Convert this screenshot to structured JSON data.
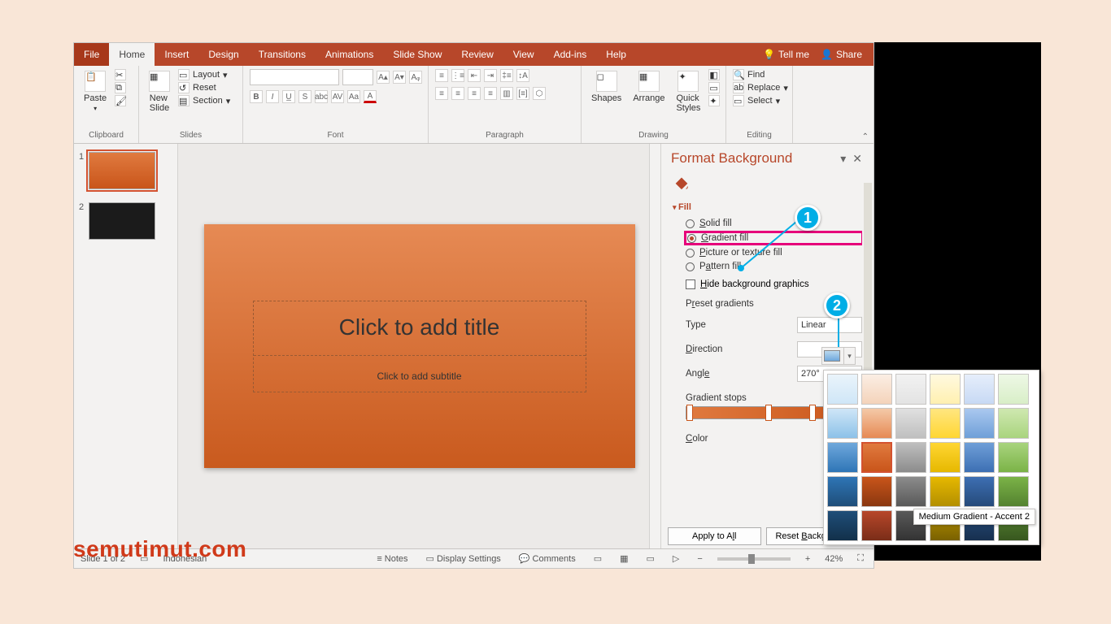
{
  "tabs": {
    "file": "File",
    "home": "Home",
    "insert": "Insert",
    "design": "Design",
    "transitions": "Transitions",
    "animations": "Animations",
    "slideshow": "Slide Show",
    "review": "Review",
    "view": "View",
    "addins": "Add-ins",
    "help": "Help",
    "tellme": "Tell me",
    "share": "Share"
  },
  "ribbon": {
    "clipboard": {
      "label": "Clipboard",
      "paste": "Paste"
    },
    "slides": {
      "label": "Slides",
      "newslide": "New\nSlide",
      "layout": "Layout",
      "reset": "Reset",
      "section": "Section"
    },
    "font": {
      "label": "Font"
    },
    "paragraph": {
      "label": "Paragraph"
    },
    "drawing": {
      "label": "Drawing",
      "shapes": "Shapes",
      "arrange": "Arrange",
      "quick": "Quick\nStyles"
    },
    "editing": {
      "label": "Editing",
      "find": "Find",
      "replace": "Replace",
      "select": "Select"
    }
  },
  "thumbs": {
    "n1": "1",
    "n2": "2"
  },
  "slide": {
    "title_ph": "Click to add title",
    "subtitle_ph": "Click to add subtitle"
  },
  "pane": {
    "title": "Format Background",
    "fill": "Fill",
    "solid": "Solid fill",
    "gradient": "Gradient fill",
    "picture": "Picture or texture fill",
    "pattern": "Pattern fill",
    "hide": "Hide background graphics",
    "preset": "Preset gradients",
    "type": "Type",
    "type_val": "Linear",
    "direction": "Direction",
    "angle": "Angle",
    "angle_val": "270°",
    "stops": "Gradient stops",
    "color": "Color",
    "apply": "Apply to All",
    "reset": "Reset Background"
  },
  "popup_tooltip": "Medium Gradient - Accent 2",
  "status": {
    "slide": "Slide 1 of 2",
    "lang": "Indonesian",
    "notes": "Notes",
    "display": "Display Settings",
    "comments": "Comments",
    "zoom": "42%"
  },
  "badges": {
    "b1": "1",
    "b2": "2"
  },
  "watermark": "semutimut.com"
}
